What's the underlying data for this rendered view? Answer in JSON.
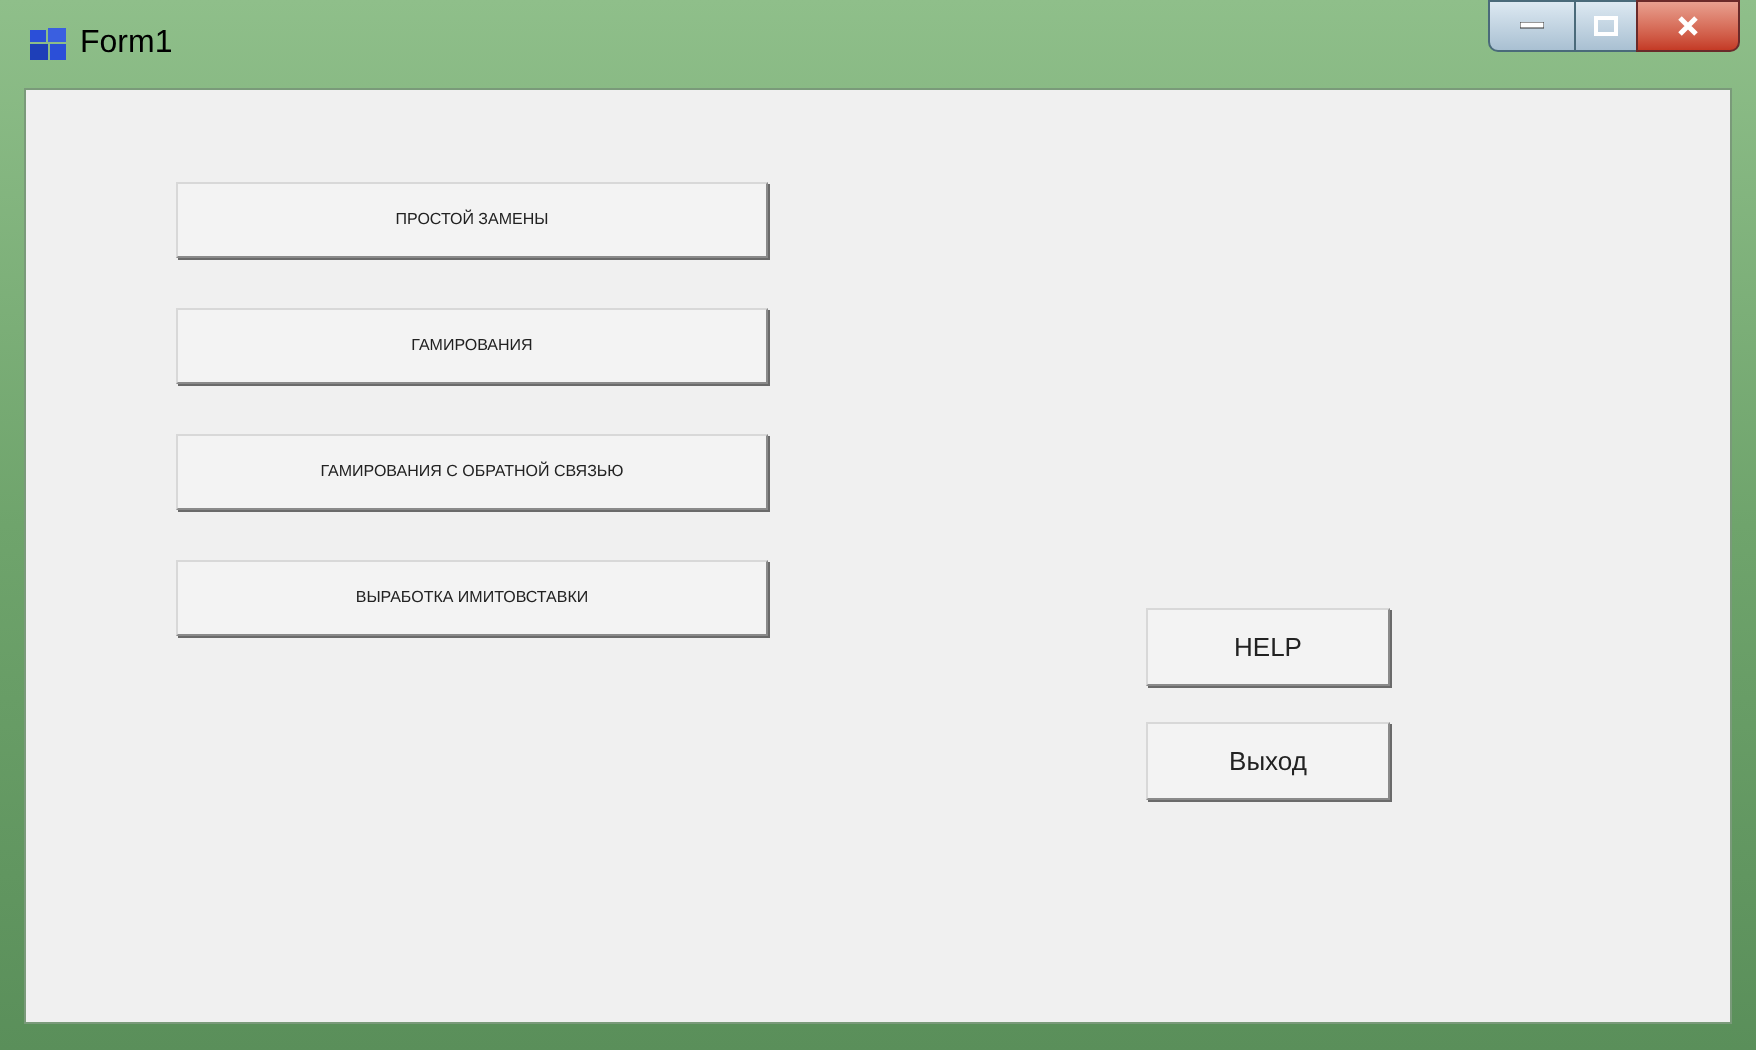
{
  "window": {
    "title": "Form1"
  },
  "cipher_buttons": [
    {
      "label": "ПРОСТОЙ ЗАМЕНЫ"
    },
    {
      "label": "ГАМИРОВАНИЯ"
    },
    {
      "label": "ГАМИРОВАНИЯ С ОБРАТНОЙ СВЯЗЬЮ"
    },
    {
      "label": "ВЫРАБОТКА ИМИТОВСТАВКИ"
    }
  ],
  "side_buttons": [
    {
      "label": "HELP"
    },
    {
      "label": "Выход"
    }
  ]
}
